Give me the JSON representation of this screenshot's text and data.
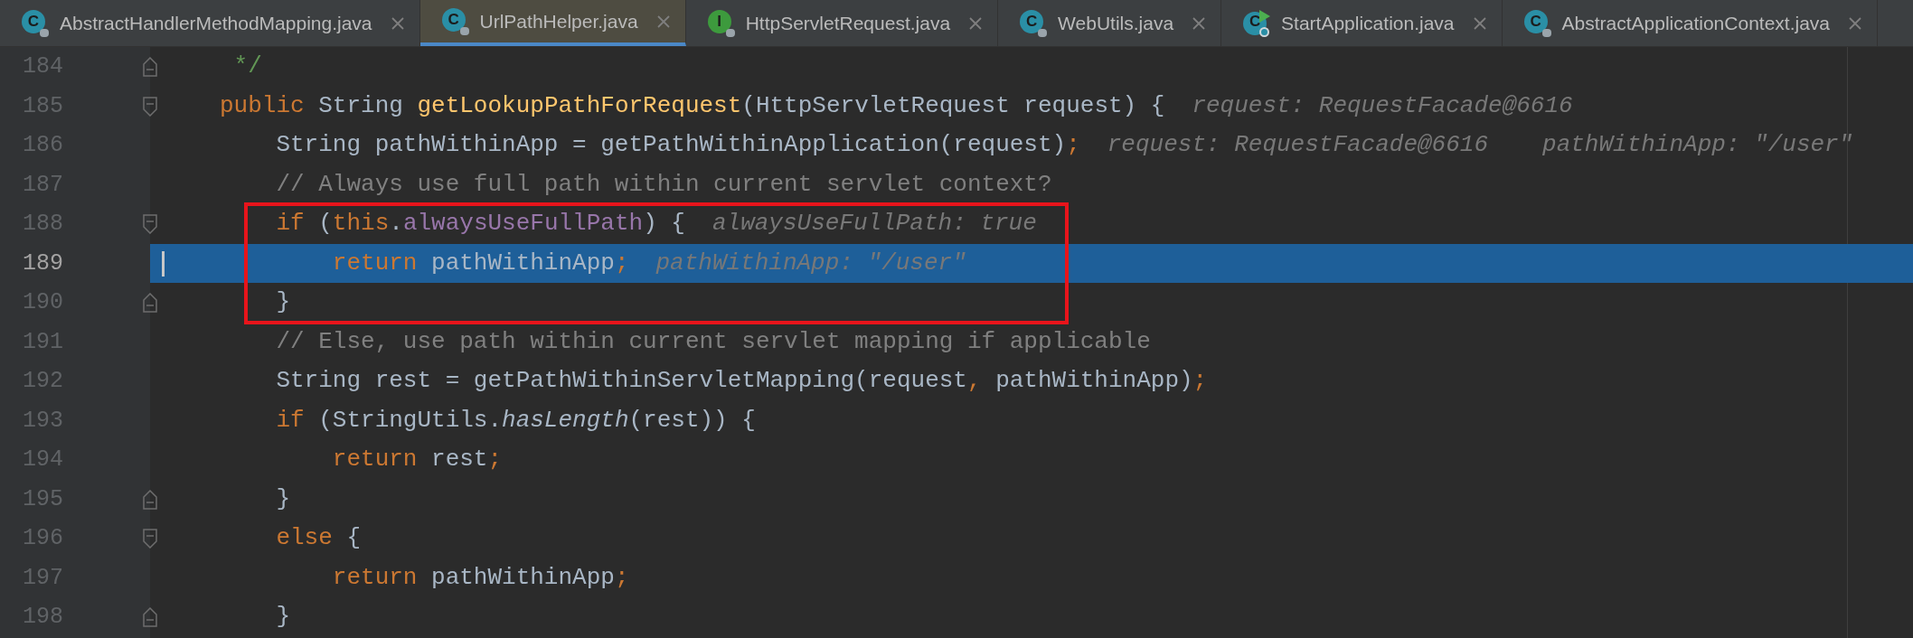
{
  "tabs": [
    {
      "label": "AbstractHandlerMethodMapping.java",
      "kind": "class",
      "badge": "C",
      "selected": false
    },
    {
      "label": "UrlPathHelper.java",
      "kind": "class",
      "badge": "C",
      "selected": true
    },
    {
      "label": "HttpServletRequest.java",
      "kind": "interface",
      "badge": "I",
      "selected": false
    },
    {
      "label": "WebUtils.java",
      "kind": "class",
      "badge": "C",
      "selected": false
    },
    {
      "label": "StartApplication.java",
      "kind": "runnable",
      "badge": "C",
      "selected": false
    },
    {
      "label": "AbstractApplicationContext.java",
      "kind": "class",
      "badge": "C",
      "selected": false
    }
  ],
  "lines": [
    {
      "number": "184",
      "kind": "fold-end",
      "selected": false,
      "boxed": false,
      "tokens": [
        {
          "kind": "doc",
          "text": " */"
        }
      ]
    },
    {
      "number": "185",
      "kind": "fold-start",
      "selected": false,
      "boxed": false,
      "tokens": [
        {
          "kind": "keyword",
          "text": "public"
        },
        {
          "kind": "plain",
          "text": " String "
        },
        {
          "kind": "method",
          "text": "getLookupPathForRequest"
        },
        {
          "kind": "plain",
          "text": "(HttpServletRequest request) {"
        }
      ],
      "hints": [
        "request: RequestFacade@6616"
      ]
    },
    {
      "number": "186",
      "kind": "plain",
      "selected": false,
      "boxed": false,
      "tokens": [
        {
          "kind": "plain",
          "text": "    String pathWithinApp = getPathWithinApplication(request)"
        },
        {
          "kind": "keyword",
          "text": ";"
        }
      ],
      "hints": [
        "request: RequestFacade@6616",
        "pathWithinApp: \"/user\""
      ]
    },
    {
      "number": "187",
      "kind": "plain",
      "selected": false,
      "boxed": false,
      "tokens": [
        {
          "kind": "comment",
          "text": "    // Always use full path within current servlet context?"
        }
      ]
    },
    {
      "number": "188",
      "kind": "fold-start",
      "selected": false,
      "boxed": true,
      "tokens": [
        {
          "kind": "keyword",
          "text": "    if"
        },
        {
          "kind": "plain",
          "text": " ("
        },
        {
          "kind": "keyword",
          "text": "this"
        },
        {
          "kind": "plain",
          "text": "."
        },
        {
          "kind": "field",
          "text": "alwaysUseFullPath"
        },
        {
          "kind": "plain",
          "text": ") {"
        }
      ],
      "hints": [
        "alwaysUseFullPath: true"
      ]
    },
    {
      "number": "189",
      "kind": "plain",
      "selected": true,
      "boxed": true,
      "tokens": [
        {
          "kind": "keyword",
          "text": "        return"
        },
        {
          "kind": "plain",
          "text": " pathWithinApp"
        },
        {
          "kind": "keyword",
          "text": ";"
        }
      ],
      "hints": [
        "pathWithinApp: \"/user\""
      ]
    },
    {
      "number": "190",
      "kind": "fold-end",
      "selected": false,
      "boxed": true,
      "tokens": [
        {
          "kind": "plain",
          "text": "    }"
        }
      ]
    },
    {
      "number": "191",
      "kind": "plain",
      "selected": false,
      "boxed": false,
      "tokens": [
        {
          "kind": "comment",
          "text": "    // Else, use path within current servlet mapping if applicable"
        }
      ]
    },
    {
      "number": "192",
      "kind": "plain",
      "selected": false,
      "boxed": false,
      "tokens": [
        {
          "kind": "plain",
          "text": "    String rest = getPathWithinServletMapping(request"
        },
        {
          "kind": "keyword",
          "text": ","
        },
        {
          "kind": "plain",
          "text": " pathWithinApp)"
        },
        {
          "kind": "keyword",
          "text": ";"
        }
      ]
    },
    {
      "number": "193",
      "kind": "plain",
      "selected": false,
      "boxed": false,
      "tokens": [
        {
          "kind": "keyword",
          "text": "    if"
        },
        {
          "kind": "plain",
          "text": " (StringUtils."
        },
        {
          "kind": "static",
          "text": "hasLength"
        },
        {
          "kind": "plain",
          "text": "(rest)) {"
        }
      ]
    },
    {
      "number": "194",
      "kind": "plain",
      "selected": false,
      "boxed": false,
      "tokens": [
        {
          "kind": "keyword",
          "text": "        return"
        },
        {
          "kind": "plain",
          "text": " rest"
        },
        {
          "kind": "keyword",
          "text": ";"
        }
      ]
    },
    {
      "number": "195",
      "kind": "fold-end",
      "selected": false,
      "boxed": false,
      "tokens": [
        {
          "kind": "plain",
          "text": "    }"
        }
      ]
    },
    {
      "number": "196",
      "kind": "fold-start",
      "selected": false,
      "boxed": false,
      "tokens": [
        {
          "kind": "keyword",
          "text": "    else"
        },
        {
          "kind": "plain",
          "text": " {"
        }
      ]
    },
    {
      "number": "197",
      "kind": "plain",
      "selected": false,
      "boxed": false,
      "tokens": [
        {
          "kind": "keyword",
          "text": "        return"
        },
        {
          "kind": "plain",
          "text": " pathWithinApp"
        },
        {
          "kind": "keyword",
          "text": ";"
        }
      ]
    },
    {
      "number": "198",
      "kind": "fold-end",
      "selected": false,
      "boxed": false,
      "tokens": [
        {
          "kind": "plain",
          "text": "    }"
        }
      ]
    }
  ]
}
